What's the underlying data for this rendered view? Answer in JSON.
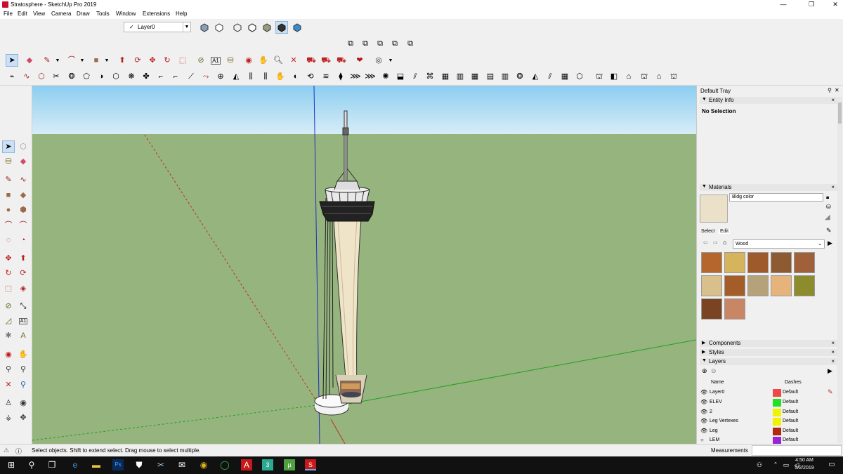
{
  "window": {
    "title": "Stratosphere - SketchUp Pro 2019",
    "buttons": [
      "—",
      "❐",
      "✕"
    ]
  },
  "menu": [
    "File",
    "Edit",
    "View",
    "Camera",
    "Draw",
    "Tools",
    "Window",
    "Extensions",
    "Help"
  ],
  "layer_toolbar": {
    "check": "✓",
    "current_layer": "Layer0"
  },
  "tray": {
    "title": "Default Tray",
    "entity_info": {
      "title": "Entity Info",
      "value": "No Selection"
    },
    "materials": {
      "title": "Materials",
      "material_name": "Bldg color",
      "tab_select": "Select",
      "tab_edit": "Edit",
      "library": "Wood",
      "swatches": [
        "#b4662c",
        "#d6b45c",
        "#9e5a2a",
        "#8e5a32",
        "#a0603a",
        "#d8bf8c",
        "#a45c28",
        "#b5a27a",
        "#e6b47a",
        "#8c8c2c",
        "#7a4422",
        "#c88664"
      ]
    },
    "components": {
      "title": "Components"
    },
    "styles": {
      "title": "Styles"
    },
    "layers": {
      "title": "Layers",
      "col_name": "Name",
      "col_dashes": "Dashes",
      "rows": [
        {
          "name": "Layer0",
          "color": "#f04848",
          "dashes": "Default"
        },
        {
          "name": "ELEV",
          "color": "#22e022",
          "dashes": "Default"
        },
        {
          "name": "2",
          "color": "#f2f200",
          "dashes": "Default"
        },
        {
          "name": "Leg Vertexes",
          "color": "#f2f200",
          "dashes": "Default"
        },
        {
          "name": "Leg",
          "color": "#b02810",
          "dashes": "Default"
        },
        {
          "name": "LEM",
          "color": "#9a22d8",
          "dashes": "Default"
        }
      ]
    }
  },
  "status": {
    "message": "Select objects. Shift to extend select. Drag mouse to select multiple.",
    "measurements_label": "Measurements"
  },
  "taskbar": {
    "time": "4:50 AM",
    "date": "5/2/2019"
  },
  "colors": {
    "sky": "#a8d8f0",
    "ground": "#95b47e",
    "axis_blue": "#2030c0",
    "axis_green": "#20a020",
    "axis_red": "#c03020"
  }
}
